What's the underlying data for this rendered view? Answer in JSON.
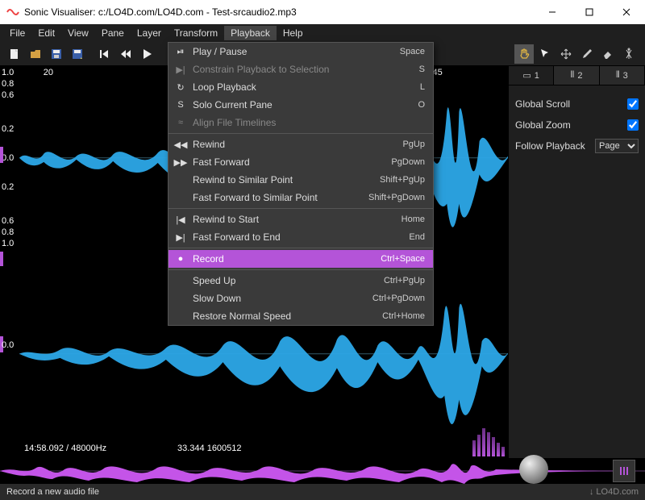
{
  "window": {
    "title": "Sonic Visualiser: c:/LO4D.com/LO4D.com - Test-srcaudio2.mp3"
  },
  "menubar": [
    "File",
    "Edit",
    "View",
    "Pane",
    "Layer",
    "Transform",
    "Playback",
    "Help"
  ],
  "menubar_active_index": 6,
  "toolbar_icons": {
    "new": "new-file-icon",
    "open": "open-folder-icon",
    "save": "save-icon",
    "saveas": "save-as-icon",
    "rewind_start": "rewind-start-icon",
    "rewind": "rewind-icon",
    "play": "play-icon"
  },
  "right_toolbar_icons": [
    "hand-icon",
    "pointer-icon",
    "move-icon",
    "pencil-icon",
    "eraser-icon",
    "measure-icon"
  ],
  "dropdown": {
    "groups": [
      [
        {
          "icon": "⏯",
          "label": "Play / Pause",
          "shortcut": "Space"
        },
        {
          "icon": "▶|",
          "label": "Constrain Playback to Selection",
          "shortcut": "S",
          "disabled": true
        },
        {
          "icon": "↻",
          "label": "Loop Playback",
          "shortcut": "L"
        },
        {
          "icon": "S",
          "label": "Solo Current Pane",
          "shortcut": "O"
        },
        {
          "icon": "≈",
          "label": "Align File Timelines",
          "shortcut": "",
          "disabled": true
        }
      ],
      [
        {
          "icon": "◀◀",
          "label": "Rewind",
          "shortcut": "PgUp"
        },
        {
          "icon": "▶▶",
          "label": "Fast Forward",
          "shortcut": "PgDown"
        },
        {
          "icon": "",
          "label": "Rewind to Similar Point",
          "shortcut": "Shift+PgUp"
        },
        {
          "icon": "",
          "label": "Fast Forward to Similar Point",
          "shortcut": "Shift+PgDown"
        }
      ],
      [
        {
          "icon": "|◀",
          "label": "Rewind to Start",
          "shortcut": "Home"
        },
        {
          "icon": "▶|",
          "label": "Fast Forward to End",
          "shortcut": "End"
        }
      ],
      [
        {
          "icon": "●",
          "label": "Record",
          "shortcut": "Ctrl+Space",
          "highlight": true
        }
      ],
      [
        {
          "icon": "",
          "label": "Speed Up",
          "shortcut": "Ctrl+PgUp"
        },
        {
          "icon": "",
          "label": "Slow Down",
          "shortcut": "Ctrl+PgDown"
        },
        {
          "icon": "",
          "label": "Restore Normal Speed",
          "shortcut": "Ctrl+Home"
        }
      ]
    ]
  },
  "waveform": {
    "y_ticks_top": [
      "1.0",
      "0.8",
      "0.6",
      "0.2",
      "0.0",
      "0.2",
      "0.6",
      "0.8",
      "1.0"
    ],
    "y_ticks_bottom": [
      "0.0"
    ],
    "time_ticks": [
      {
        "label": "20",
        "x_pct": 5
      },
      {
        "label": "45",
        "x_pct": 86
      }
    ],
    "info_left": "14:58.092 / 48000Hz",
    "info_center": "33.344  1600512"
  },
  "right_panel": {
    "tabs": [
      {
        "icon": "▭",
        "label": "1"
      },
      {
        "icon": "⦀",
        "label": "2"
      },
      {
        "icon": "⦀",
        "label": "3"
      }
    ],
    "active_tab": 0,
    "rows": [
      {
        "label": "Global Scroll",
        "type": "check",
        "checked": true
      },
      {
        "label": "Global Zoom",
        "type": "check",
        "checked": true
      },
      {
        "label": "Follow Playback",
        "type": "select",
        "value": "Page"
      }
    ]
  },
  "statusbar": {
    "text": "Record a new audio file",
    "brand": "↓ LO4D.com"
  }
}
